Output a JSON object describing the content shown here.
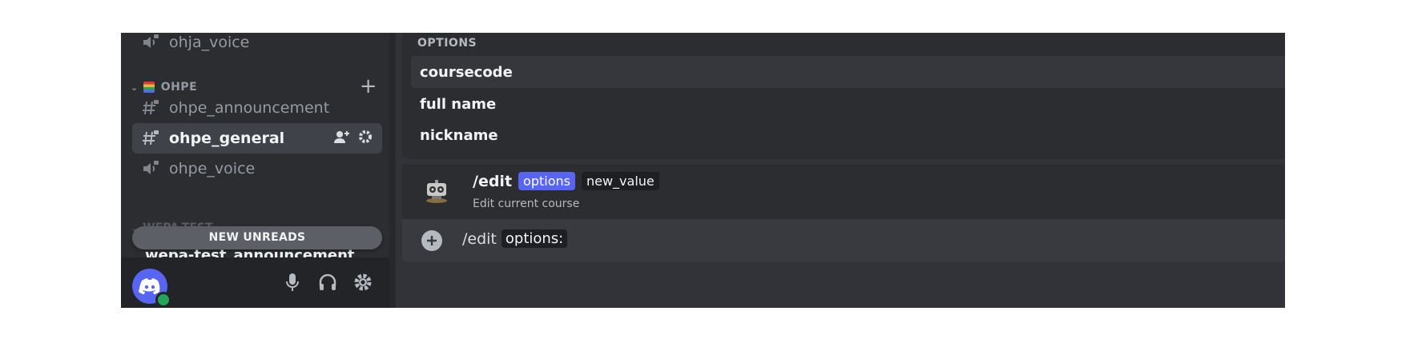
{
  "sidebar": {
    "channels": [
      {
        "name": "ohja_voice",
        "type": "voice"
      },
      {
        "name": "ohpe_announcement",
        "type": "text"
      },
      {
        "name": "ohpe_general",
        "type": "text",
        "active": true
      },
      {
        "name": "ohpe_voice",
        "type": "voice"
      }
    ],
    "category": {
      "name": "OHPE",
      "icon": "books-emoji-icon"
    },
    "faded_category": "WEPA-TEST",
    "new_unreads": "NEW UNREADS",
    "peek_channel": "wepa-test_announcement"
  },
  "options_popup": {
    "header": "OPTIONS",
    "items": [
      "coursecode",
      "full name",
      "nickname"
    ],
    "selected_index": 0
  },
  "command": {
    "name": "/edit",
    "params": [
      "options",
      "new_value"
    ],
    "description": "Edit current course",
    "icon": "robot-bot-icon"
  },
  "input": {
    "prefix": "/edit",
    "param": "options:"
  },
  "colors": {
    "accent": "#5865f2",
    "online": "#23a55a",
    "sidebar": "#2b2d31",
    "main": "#313338"
  }
}
